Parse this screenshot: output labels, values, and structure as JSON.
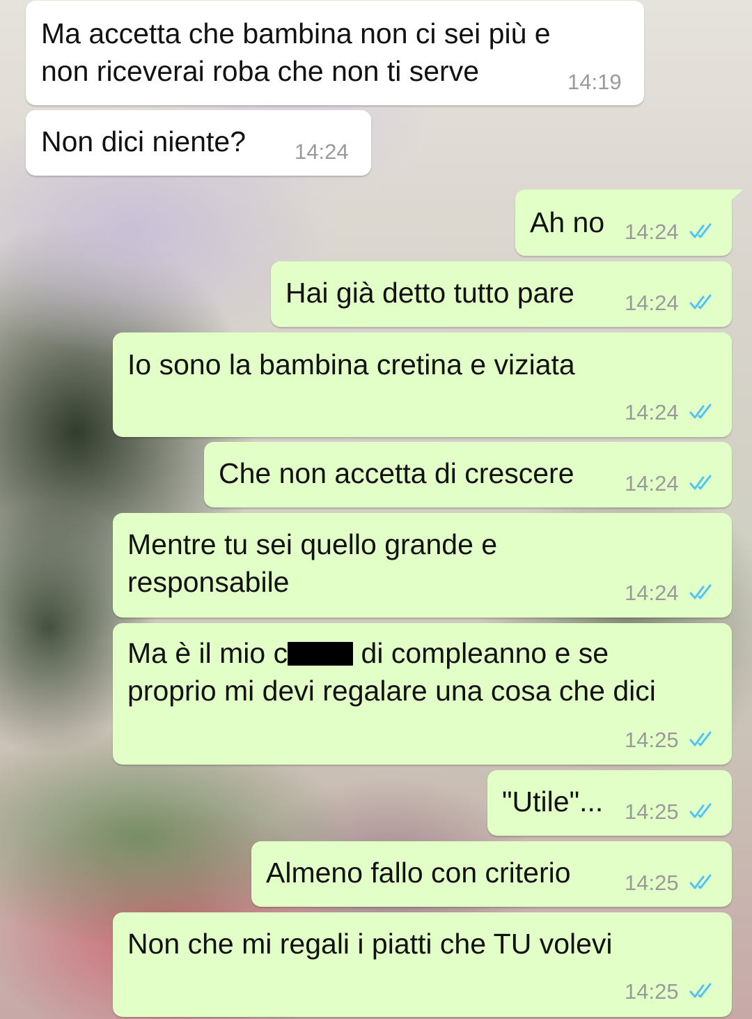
{
  "chat": {
    "colors": {
      "incoming_bubble": "#ffffff",
      "outgoing_bubble": "#e1ffc7",
      "timestamp": "#9a9a9a",
      "read_ticks": "#4fc3f7"
    },
    "messages": [
      {
        "direction": "in",
        "lines": [
          "Ma accetta che bambina non ci sei più e",
          "non riceverai roba che non ti serve"
        ],
        "time": "14:19"
      },
      {
        "direction": "in",
        "lines": [
          "Non dici niente?"
        ],
        "time": "14:24"
      },
      {
        "direction": "out",
        "lines": [
          "Ah no"
        ],
        "time": "14:24",
        "status": "read-ticks-icon"
      },
      {
        "direction": "out",
        "lines": [
          "Hai già detto tutto pare"
        ],
        "time": "14:24",
        "status": "read-ticks-icon"
      },
      {
        "direction": "out",
        "lines": [
          "Io sono la bambina cretina e viziata"
        ],
        "time": "14:24",
        "status": "read-ticks-icon"
      },
      {
        "direction": "out",
        "lines": [
          "Che non accetta di crescere"
        ],
        "time": "14:24",
        "status": "read-ticks-icon"
      },
      {
        "direction": "out",
        "lines": [
          "Mentre tu sei quello grande e",
          "responsabile"
        ],
        "time": "14:24",
        "status": "read-ticks-icon"
      },
      {
        "direction": "out",
        "lines": [
          "Ma è il mio c",
          "di compleanno e se",
          "proprio mi devi regalare una cosa che dici"
        ],
        "redacted": true,
        "time": "14:25",
        "status": "read-ticks-icon"
      },
      {
        "direction": "out",
        "lines": [
          "\"Utile\"..."
        ],
        "time": "14:25",
        "status": "read-ticks-icon"
      },
      {
        "direction": "out",
        "lines": [
          "Almeno fallo con criterio"
        ],
        "time": "14:25",
        "status": "read-ticks-icon"
      },
      {
        "direction": "out",
        "lines": [
          "Non che mi regali i piatti che TU volevi"
        ],
        "time": "14:25",
        "status": "read-ticks-icon"
      }
    ]
  }
}
